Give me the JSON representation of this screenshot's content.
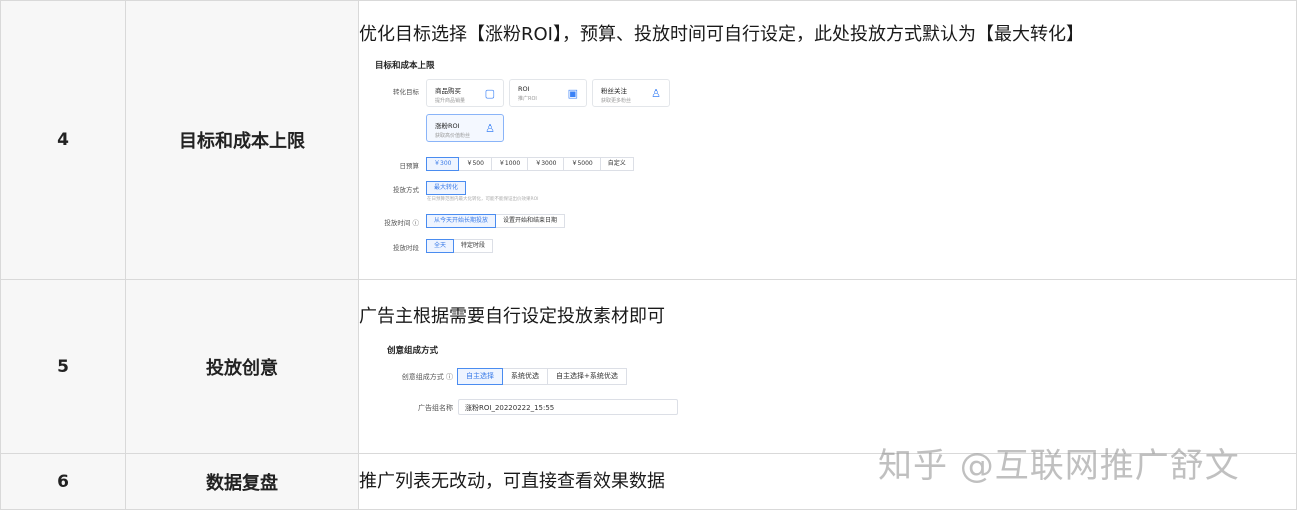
{
  "rows": [
    {
      "num": "4",
      "title": "目标和成本上限",
      "desc": "优化目标选择【涨粉ROI】，预算、投放时间可自行设定，此处投放方式默认为【最大转化】",
      "panel": {
        "section_title": "目标和成本上限",
        "target_label": "转化目标",
        "cards": [
          {
            "title": "商品购买",
            "sub": "提升商品销量",
            "icon": "cart-icon"
          },
          {
            "title": "ROI",
            "sub": "推广ROI",
            "icon": "calendar-icon"
          },
          {
            "title": "粉丝关注",
            "sub": "获取更多粉丝",
            "icon": "user-add-icon"
          },
          {
            "title": "涨粉ROI",
            "sub": "获取高价值粉丝",
            "icon": "user-icon"
          }
        ],
        "budget_label": "日预算",
        "budget_options": [
          "￥300",
          "￥500",
          "￥1000",
          "￥3000",
          "￥5000",
          "自定义"
        ],
        "method_label": "投放方式",
        "method_value": "最大转化",
        "method_hint": "在日预算范围内最大化转化，可能不能保证出价效果ROI",
        "time_label": "投放时间 ⓘ",
        "time_options": [
          "从今天开始长期投放",
          "设置开始和结束日期"
        ],
        "period_label": "投放时段",
        "period_options": [
          "全天",
          "特定时段"
        ]
      }
    },
    {
      "num": "5",
      "title": "投放创意",
      "desc": "广告主根据需要自行设定投放素材即可",
      "panel": {
        "section_title": "创意组成方式",
        "compose_label": "创意组成方式 ⓘ",
        "compose_options": [
          "自主选择",
          "系统优选",
          "自主选择+系统优选"
        ],
        "name_label": "广告组名称",
        "name_value": "涨粉ROI_20220222_15:55"
      }
    },
    {
      "num": "6",
      "title": "数据复盘",
      "desc": "推广列表无改动，可直接查看效果数据"
    }
  ],
  "watermark": "知乎 @互联网推广舒文"
}
